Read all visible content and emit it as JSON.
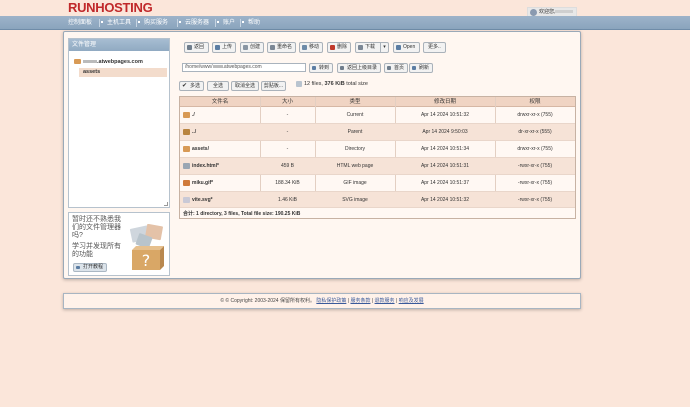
{
  "brand": {
    "logo": "RUNHOSTING"
  },
  "user": {
    "greeting": "欢迎您,",
    "name_suffix": ""
  },
  "nav": [
    {
      "label": "控制面板"
    },
    {
      "label": "主机工具"
    },
    {
      "label": "购买服务"
    },
    {
      "label": "云服务器"
    },
    {
      "label": "账户"
    },
    {
      "label": "帮助"
    }
  ],
  "sidebar": {
    "title": "文件管理",
    "root": ".atwebpages.com",
    "child": "assets"
  },
  "help": {
    "line1": "暂时还不熟悉我们的文件管理器吗?",
    "line2": "学习并发现所有的功能",
    "button": "打开教程"
  },
  "toolbar": {
    "back": "返回",
    "upload": "上传",
    "create": "创建",
    "rename": "重命名",
    "move": "移动",
    "delete": "删除",
    "download": "下载",
    "open": "Open",
    "more": "更多.."
  },
  "pathbar": {
    "value_prefix": "/home/www/",
    "value_suffix": ".atwebpages.com",
    "goto": "转到",
    "up": "返回上级目录",
    "home": "首页",
    "refresh": "刷新"
  },
  "selection": {
    "multi": "多选",
    "all": "全选",
    "none": "取消全选",
    "clipboard": "剪贴板..."
  },
  "summary": {
    "prefix": "12 files, ",
    "size": "376 KiB",
    "suffix": " total size"
  },
  "table": {
    "headers": [
      "文件名",
      "大小",
      "类型",
      "修改日期",
      "权限"
    ],
    "rows": [
      {
        "name": "./",
        "size": "-",
        "type": "Current",
        "date": "Apr 14 2024 10:51:32",
        "perm": "drwxr-xr-x (755)",
        "icon": "folder-icon",
        "color": "#d89a55"
      },
      {
        "name": "../",
        "size": "-",
        "type": "Parent",
        "date": "Apr 14 2024 9:50:03",
        "perm": "dr-xr-xr-x (555)",
        "icon": "up-folder-icon",
        "color": "#b8843f"
      },
      {
        "name": "assets/",
        "size": "-",
        "type": "Directory",
        "date": "Apr 14 2024 10:51:34",
        "perm": "drwxr-xr-x (755)",
        "icon": "folder-icon",
        "color": "#d89a55"
      },
      {
        "name": "index.html*",
        "size": "459 B",
        "type": "HTML web page",
        "date": "Apr 14 2024 10:51:31",
        "perm": "-rwxr-xr-x (755)",
        "icon": "html-file-icon",
        "color": "#9aa6b3"
      },
      {
        "name": "miku.gif*",
        "size": "188.34 KiB",
        "type": "GIF image",
        "date": "Apr 14 2024 10:51:37",
        "perm": "-rwxr-xr-x (755)",
        "icon": "image-file-icon",
        "color": "#d07a3a"
      },
      {
        "name": "vite.svg*",
        "size": "1.46 KiB",
        "type": "SVG image",
        "date": "Apr 14 2024 10:51:32",
        "perm": "-rwxr-xr-x (755)",
        "icon": "svg-file-icon",
        "color": "#c9c9d6"
      }
    ],
    "total": "合计: 1 directory, 3 files, Total file size: 190.25 KiB"
  },
  "footer": {
    "copyright": "© © Copyright: 2003-2024 保留所有权利。",
    "links": [
      "隐私保护政策",
      "服务条款",
      "退款服务",
      "响应及发展"
    ]
  }
}
